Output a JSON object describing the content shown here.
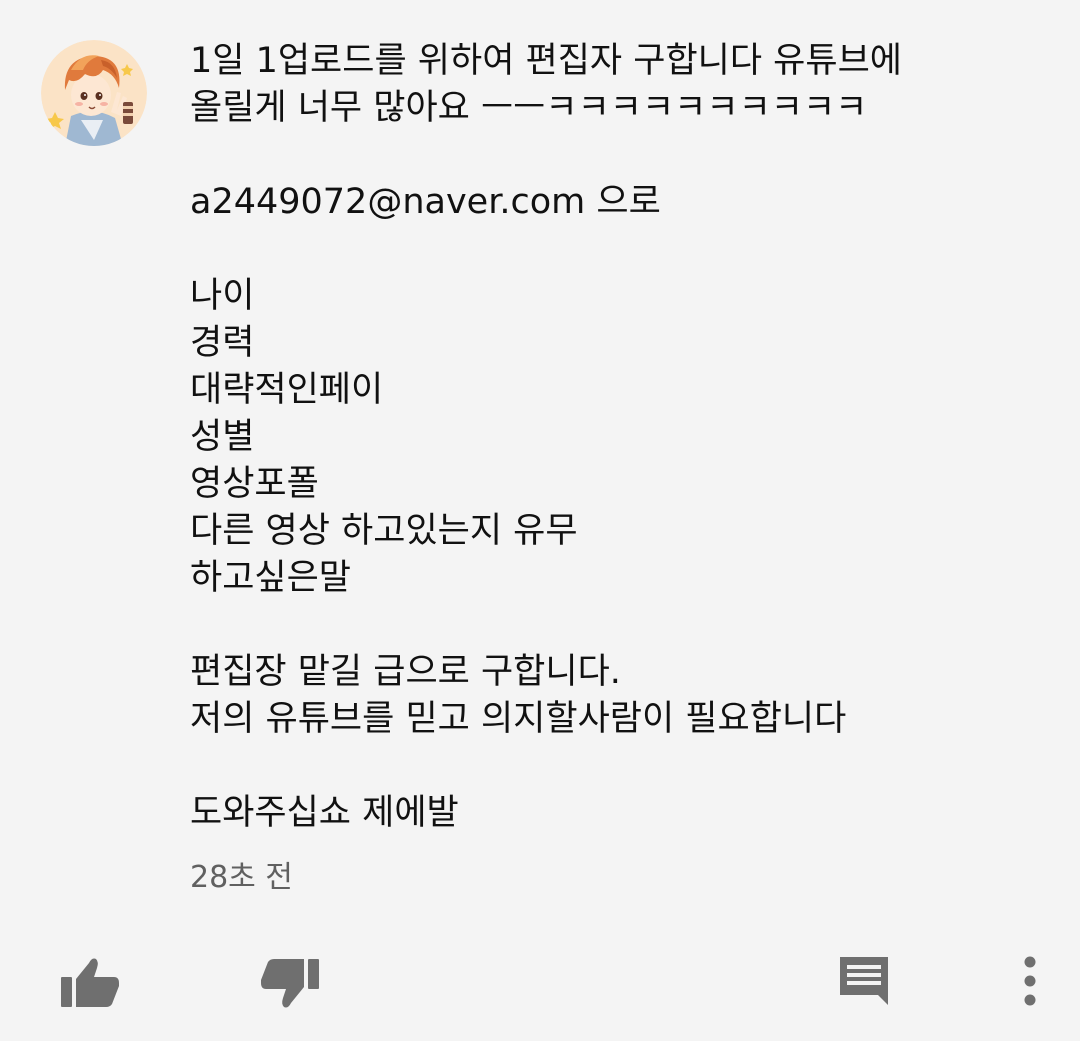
{
  "comment": {
    "avatar_icon": "user-avatar-illustration",
    "lines": [
      "1일 1업로드를 위하여 편집자 구합니다 유튜브에",
      "올릴게 너무 많아요 ㅡㅡㅋㅋㅋㅋㅋㅋㅋㅋㅋㅋ",
      "",
      "a2449072@naver.com 으로",
      "",
      "나이",
      "경력",
      "대략적인페이",
      "성별",
      "영상포폴",
      "다른 영상 하고있는지 유무",
      "하고싶은말",
      "",
      "편집장 맡길 급으로 구합니다.",
      "저의 유튜브를 믿고 의지할사람이 필요합니다",
      "",
      "도와주십쇼 제에발"
    ],
    "timestamp": "28초 전"
  },
  "actions": {
    "like_icon": "thumb-up-icon",
    "dislike_icon": "thumb-down-icon",
    "reply_icon": "comment-reply-icon",
    "more_icon": "more-vertical-icon",
    "icon_color": "#6f6f6f"
  }
}
